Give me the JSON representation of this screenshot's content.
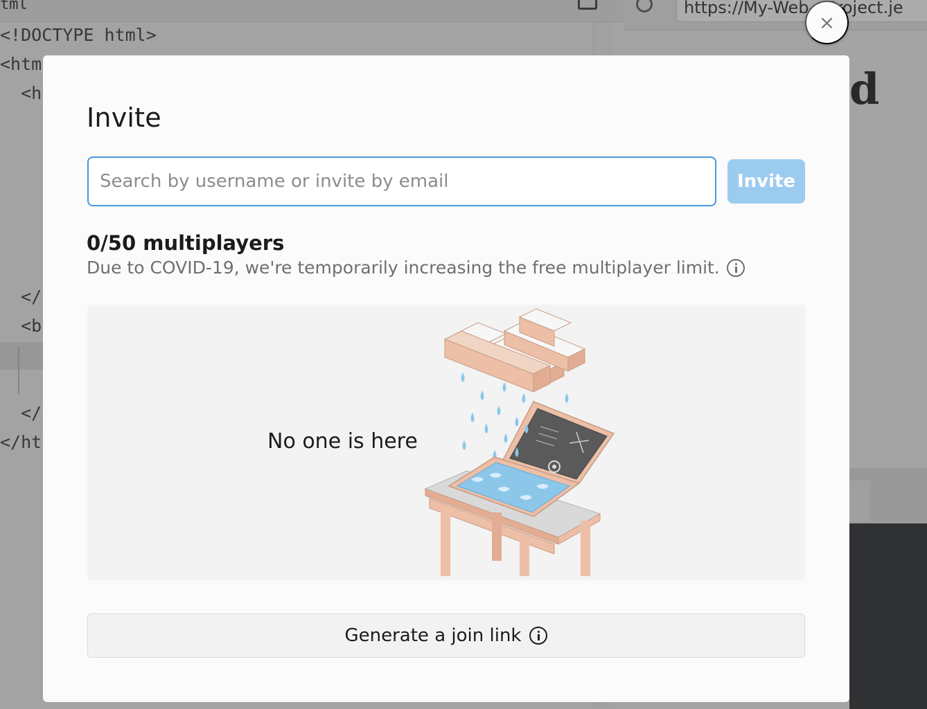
{
  "background": {
    "editor_filename": "tml",
    "code_lines": [
      "<!DOCTYPE html>",
      "<htm",
      "  <h",
      "  </",
      "  <b",
      "  </",
      "</ht"
    ],
    "url": "https://My-Web-    -Project.je",
    "page_heading": "d"
  },
  "modal": {
    "close_label": "×",
    "title": "Invite",
    "search": {
      "placeholder": "Search by username or invite by email",
      "value": ""
    },
    "invite_button": "Invite",
    "multiplayer_count": "0/50 multiplayers",
    "covid_note": "Due to COVID-19, we're temporarily increasing the free multiplayer limit.",
    "empty_state": {
      "text": "No one is here",
      "illustration": "rain-cloud-over-laptop"
    },
    "join_link_button": "Generate a join link",
    "icons": {
      "info": "info-icon",
      "close": "close-icon"
    }
  },
  "colors": {
    "accent": "#4b95e0",
    "invite_disabled": "#9ccbf0",
    "illustration_peach": "#ecbfa6",
    "illustration_water": "#8cc7ea"
  }
}
